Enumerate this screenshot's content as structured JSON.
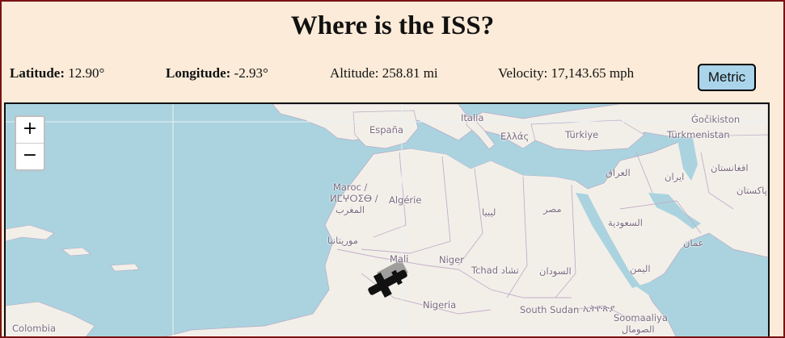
{
  "title": "Where is the ISS?",
  "stats": {
    "latitude": {
      "label": "Latitude:",
      "value": "12.90°"
    },
    "longitude": {
      "label": "Longitude:",
      "value": "-2.93°"
    },
    "altitude": {
      "label": "Altitude:",
      "value": "258.81 mi"
    },
    "velocity": {
      "label": "Velocity:",
      "value": "17,143.65 mph"
    }
  },
  "units_button": "Metric",
  "map": {
    "zoom_in": "+",
    "zoom_out": "−",
    "iss_icon": "satellite-icon",
    "labels": {
      "espana": "España",
      "italia": "Italia",
      "ellas": "Ελλάς",
      "turkiye": "Türkiye",
      "turkmenistan": "Türkmenistan",
      "dzhikiston": "Ǵočikiston",
      "iraq": "العراق",
      "iran": "ایران",
      "afghanistan": "افغانستان",
      "pakistan": "پاکستان",
      "maroc_1": "Maroc /",
      "maroc_2": "ⵍⵎⵖⵔⵉⴱ /",
      "maroc_3": "المغرب",
      "algerie": "Algérie",
      "libya": "ليبيا",
      "misr": "مصر",
      "saudi": "السعودية",
      "oman": "عمان",
      "mauritania": "موريتانيا",
      "mali": "Mali",
      "niger": "Niger",
      "tchad": "Tchad تشاد",
      "sudan": "السودان",
      "yemen": "اليمن",
      "nigeria": "Nigeria",
      "south_sudan": "South Sudan",
      "ethiopia": "ኢትዮጵያ",
      "soomaaliya": "Soomaaliya",
      "somalia_ar": "الصومال",
      "colombia": "Colombia"
    }
  }
}
